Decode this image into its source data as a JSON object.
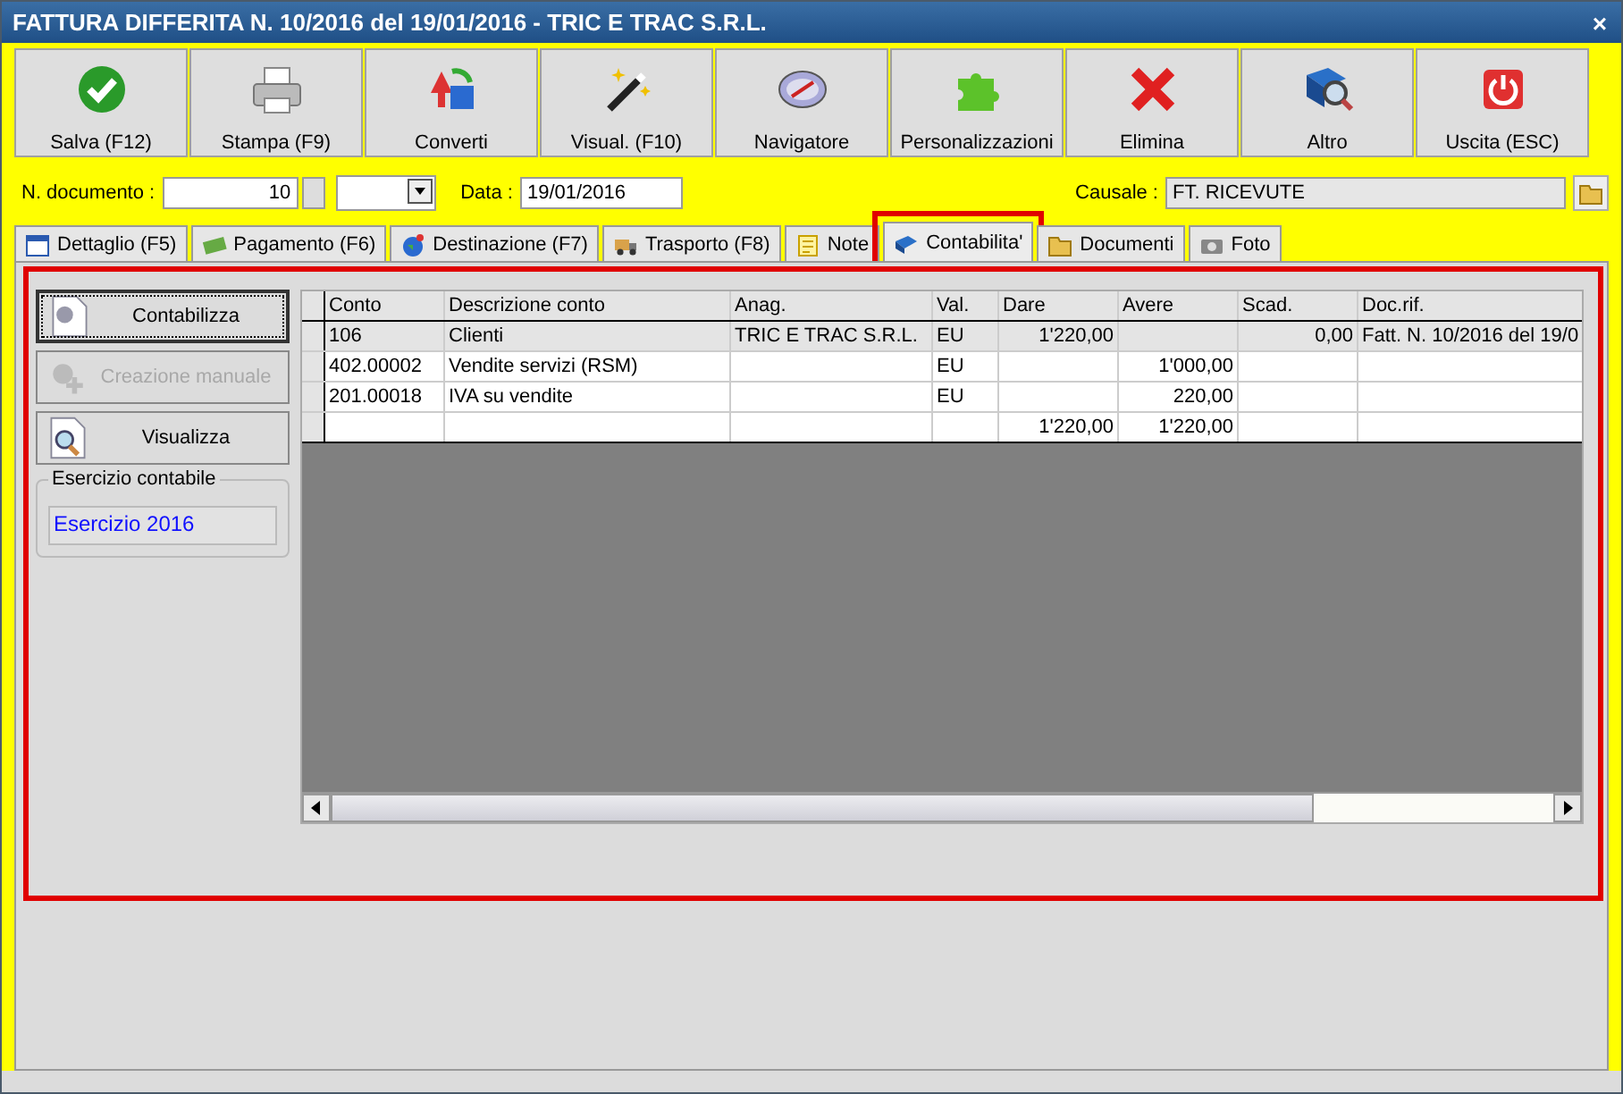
{
  "window": {
    "title": "FATTURA DIFFERITA N. 10/2016 del 19/01/2016 - TRIC E TRAC S.R.L.",
    "close": "×"
  },
  "toolbar": [
    "Salva (F12)",
    "Stampa (F9)",
    "Converti",
    "Visual. (F10)",
    "Navigatore",
    "Personalizzazioni",
    "Elimina",
    "Altro",
    "Uscita (ESC)"
  ],
  "form": {
    "number_label": "N. documento :",
    "number": "10",
    "date_label": "Data :",
    "date": "19/01/2016",
    "causale_label": "Causale :",
    "causale": "FT. RICEVUTE"
  },
  "tabs": [
    {
      "label": "Dettaglio (F5)",
      "selected": false,
      "highlighted": false
    },
    {
      "label": "Pagamento (F6)",
      "selected": false,
      "highlighted": false
    },
    {
      "label": "Destinazione (F7)",
      "selected": false,
      "highlighted": false
    },
    {
      "label": "Trasporto (F8)",
      "selected": false,
      "highlighted": false
    },
    {
      "label": "Note",
      "selected": false,
      "highlighted": false
    },
    {
      "label": "Contabilita'",
      "selected": true,
      "highlighted": true
    },
    {
      "label": "Documenti",
      "selected": false,
      "highlighted": false
    },
    {
      "label": "Foto",
      "selected": false,
      "highlighted": false
    }
  ],
  "panel": {
    "highlighted": true
  },
  "actions": [
    {
      "label": "Contabilizza",
      "disabled": false,
      "focused": true
    },
    {
      "label": "Creazione manuale",
      "disabled": true,
      "focused": false
    },
    {
      "label": "Visualizza",
      "disabled": false,
      "focused": false
    }
  ],
  "fiscal_year": {
    "label": "Esercizio contabile",
    "value": "Esercizio 2016"
  },
  "table": {
    "columns": [
      "Conto",
      "Descrizione conto",
      "Anag.",
      "Val.",
      "Dare",
      "Avere",
      "Scad.",
      "Doc.rif."
    ],
    "rows": [
      {
        "selected": true,
        "cells": [
          "106",
          "Clienti",
          "TRIC E TRAC S.R.L.",
          "EU",
          "1'220,00",
          "",
          "0,00",
          "Fatt. N. 10/2016 del 19/0"
        ]
      },
      {
        "selected": false,
        "cells": [
          "402.00002",
          "Vendite servizi (RSM)",
          "",
          "EU",
          "",
          "1'000,00",
          "",
          ""
        ]
      },
      {
        "selected": false,
        "cells": [
          "201.00018",
          "IVA su vendite",
          "",
          "EU",
          "",
          "220,00",
          "",
          ""
        ]
      },
      {
        "selected": false,
        "cells": [
          "",
          "",
          "",
          "",
          "1'220,00",
          "1'220,00",
          "",
          ""
        ]
      }
    ]
  }
}
